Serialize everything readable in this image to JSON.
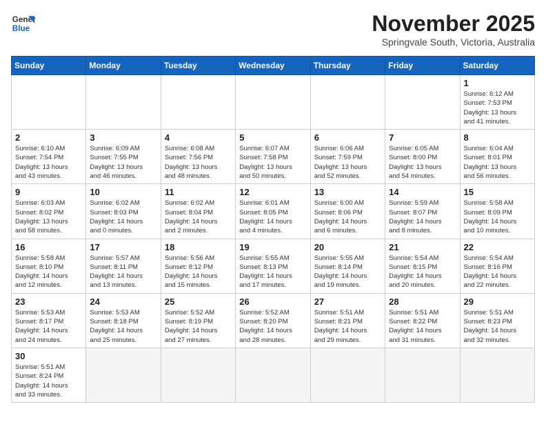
{
  "header": {
    "logo_line1": "General",
    "logo_line2": "Blue",
    "month": "November 2025",
    "location": "Springvale South, Victoria, Australia"
  },
  "weekdays": [
    "Sunday",
    "Monday",
    "Tuesday",
    "Wednesday",
    "Thursday",
    "Friday",
    "Saturday"
  ],
  "weeks": [
    [
      {
        "day": "",
        "info": ""
      },
      {
        "day": "",
        "info": ""
      },
      {
        "day": "",
        "info": ""
      },
      {
        "day": "",
        "info": ""
      },
      {
        "day": "",
        "info": ""
      },
      {
        "day": "",
        "info": ""
      },
      {
        "day": "1",
        "info": "Sunrise: 6:12 AM\nSunset: 7:53 PM\nDaylight: 13 hours\nand 41 minutes."
      }
    ],
    [
      {
        "day": "2",
        "info": "Sunrise: 6:10 AM\nSunset: 7:54 PM\nDaylight: 13 hours\nand 43 minutes."
      },
      {
        "day": "3",
        "info": "Sunrise: 6:09 AM\nSunset: 7:55 PM\nDaylight: 13 hours\nand 46 minutes."
      },
      {
        "day": "4",
        "info": "Sunrise: 6:08 AM\nSunset: 7:56 PM\nDaylight: 13 hours\nand 48 minutes."
      },
      {
        "day": "5",
        "info": "Sunrise: 6:07 AM\nSunset: 7:58 PM\nDaylight: 13 hours\nand 50 minutes."
      },
      {
        "day": "6",
        "info": "Sunrise: 6:06 AM\nSunset: 7:59 PM\nDaylight: 13 hours\nand 52 minutes."
      },
      {
        "day": "7",
        "info": "Sunrise: 6:05 AM\nSunset: 8:00 PM\nDaylight: 13 hours\nand 54 minutes."
      },
      {
        "day": "8",
        "info": "Sunrise: 6:04 AM\nSunset: 8:01 PM\nDaylight: 13 hours\nand 56 minutes."
      }
    ],
    [
      {
        "day": "9",
        "info": "Sunrise: 6:03 AM\nSunset: 8:02 PM\nDaylight: 13 hours\nand 58 minutes."
      },
      {
        "day": "10",
        "info": "Sunrise: 6:02 AM\nSunset: 8:03 PM\nDaylight: 14 hours\nand 0 minutes."
      },
      {
        "day": "11",
        "info": "Sunrise: 6:02 AM\nSunset: 8:04 PM\nDaylight: 14 hours\nand 2 minutes."
      },
      {
        "day": "12",
        "info": "Sunrise: 6:01 AM\nSunset: 8:05 PM\nDaylight: 14 hours\nand 4 minutes."
      },
      {
        "day": "13",
        "info": "Sunrise: 6:00 AM\nSunset: 8:06 PM\nDaylight: 14 hours\nand 6 minutes."
      },
      {
        "day": "14",
        "info": "Sunrise: 5:59 AM\nSunset: 8:07 PM\nDaylight: 14 hours\nand 8 minutes."
      },
      {
        "day": "15",
        "info": "Sunrise: 5:58 AM\nSunset: 8:09 PM\nDaylight: 14 hours\nand 10 minutes."
      }
    ],
    [
      {
        "day": "16",
        "info": "Sunrise: 5:58 AM\nSunset: 8:10 PM\nDaylight: 14 hours\nand 12 minutes."
      },
      {
        "day": "17",
        "info": "Sunrise: 5:57 AM\nSunset: 8:11 PM\nDaylight: 14 hours\nand 13 minutes."
      },
      {
        "day": "18",
        "info": "Sunrise: 5:56 AM\nSunset: 8:12 PM\nDaylight: 14 hours\nand 15 minutes."
      },
      {
        "day": "19",
        "info": "Sunrise: 5:55 AM\nSunset: 8:13 PM\nDaylight: 14 hours\nand 17 minutes."
      },
      {
        "day": "20",
        "info": "Sunrise: 5:55 AM\nSunset: 8:14 PM\nDaylight: 14 hours\nand 19 minutes."
      },
      {
        "day": "21",
        "info": "Sunrise: 5:54 AM\nSunset: 8:15 PM\nDaylight: 14 hours\nand 20 minutes."
      },
      {
        "day": "22",
        "info": "Sunrise: 5:54 AM\nSunset: 8:16 PM\nDaylight: 14 hours\nand 22 minutes."
      }
    ],
    [
      {
        "day": "23",
        "info": "Sunrise: 5:53 AM\nSunset: 8:17 PM\nDaylight: 14 hours\nand 24 minutes."
      },
      {
        "day": "24",
        "info": "Sunrise: 5:53 AM\nSunset: 8:18 PM\nDaylight: 14 hours\nand 25 minutes."
      },
      {
        "day": "25",
        "info": "Sunrise: 5:52 AM\nSunset: 8:19 PM\nDaylight: 14 hours\nand 27 minutes."
      },
      {
        "day": "26",
        "info": "Sunrise: 5:52 AM\nSunset: 8:20 PM\nDaylight: 14 hours\nand 28 minutes."
      },
      {
        "day": "27",
        "info": "Sunrise: 5:51 AM\nSunset: 8:21 PM\nDaylight: 14 hours\nand 29 minutes."
      },
      {
        "day": "28",
        "info": "Sunrise: 5:51 AM\nSunset: 8:22 PM\nDaylight: 14 hours\nand 31 minutes."
      },
      {
        "day": "29",
        "info": "Sunrise: 5:51 AM\nSunset: 8:23 PM\nDaylight: 14 hours\nand 32 minutes."
      }
    ],
    [
      {
        "day": "30",
        "info": "Sunrise: 5:51 AM\nSunset: 8:24 PM\nDaylight: 14 hours\nand 33 minutes."
      },
      {
        "day": "",
        "info": ""
      },
      {
        "day": "",
        "info": ""
      },
      {
        "day": "",
        "info": ""
      },
      {
        "day": "",
        "info": ""
      },
      {
        "day": "",
        "info": ""
      },
      {
        "day": "",
        "info": ""
      }
    ]
  ]
}
